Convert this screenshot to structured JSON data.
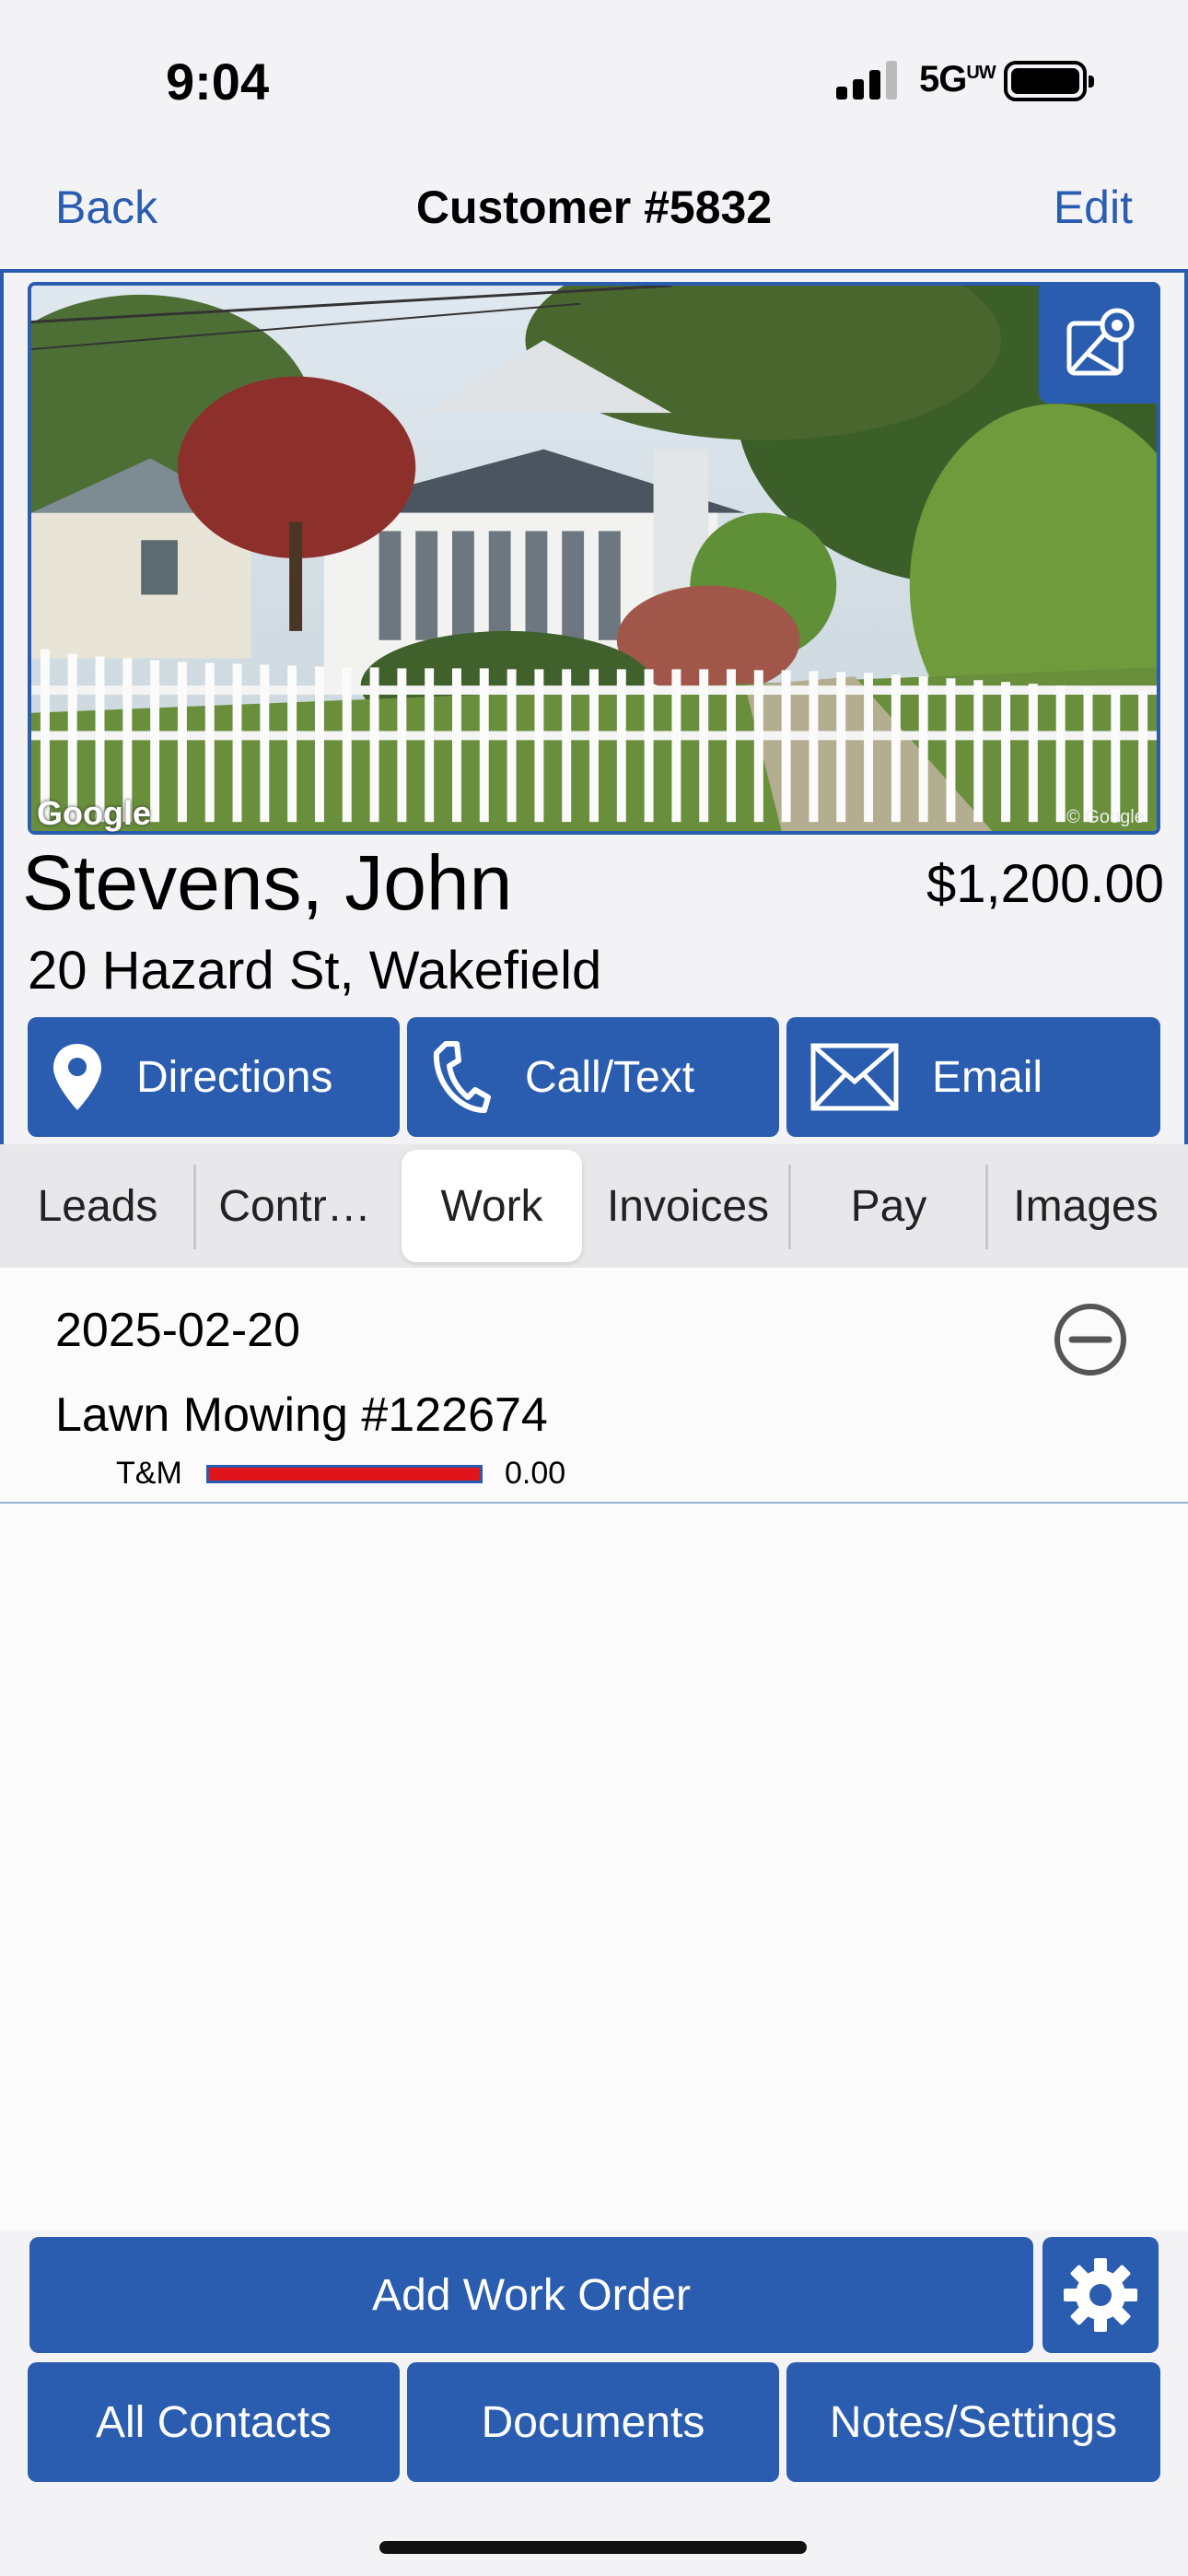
{
  "status_bar": {
    "time": "9:04",
    "network": "5G",
    "network_sup": "UW"
  },
  "nav": {
    "back": "Back",
    "title": "Customer #5832",
    "edit": "Edit"
  },
  "photo": {
    "watermark_left": "Google",
    "watermark_right": "© Google",
    "map_button_icon": "map-pin-icon"
  },
  "customer": {
    "name": "Stevens, John",
    "balance": "$1,200.00",
    "address": "20 Hazard St, Wakefield"
  },
  "actions": [
    {
      "label": "Directions",
      "icon": "location-pin-icon"
    },
    {
      "label": "Call/Text",
      "icon": "phone-icon"
    },
    {
      "label": "Email",
      "icon": "envelope-icon"
    }
  ],
  "tabs": [
    {
      "label": "Leads"
    },
    {
      "label": "Contr…"
    },
    {
      "label": "Work",
      "selected": true
    },
    {
      "label": "Invoices"
    },
    {
      "label": "Pay"
    },
    {
      "label": "Images"
    }
  ],
  "work_orders": [
    {
      "date": "2025-02-20",
      "title": "Lawn Mowing #122674",
      "type": "T&M",
      "amount": "0.00",
      "progress": 1.0
    }
  ],
  "bottom": {
    "add_work_order": "Add Work Order",
    "all_contacts": "All Contacts",
    "documents": "Documents",
    "notes_settings": "Notes/Settings"
  },
  "colors": {
    "accent": "#2a5db0",
    "progress_bar": "#e0151b"
  }
}
